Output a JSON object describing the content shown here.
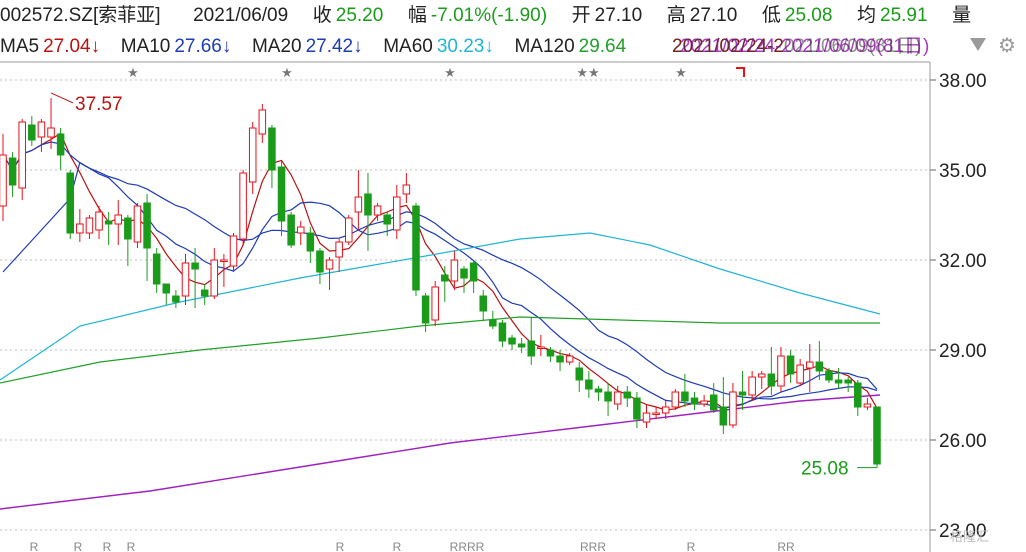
{
  "header": {
    "code": "002572.SZ[索菲亚]",
    "date": "2021/06/09",
    "close_label": "收",
    "close": "25.20",
    "change_label": "幅",
    "change": "-7.01%(-1.90)",
    "open_label": "开",
    "open": "27.10",
    "high_label": "高",
    "high": "27.10",
    "low_label": "低",
    "low": "25.08",
    "avg_label": "均",
    "avg": "25.91",
    "vol_label": "量"
  },
  "ma_bar": {
    "ma5": "MA5",
    "ma5_val": "27.04↓",
    "ma10": "MA10",
    "ma10_val": "27.66↓",
    "ma20": "MA20",
    "ma20_val": "27.42↓",
    "ma60": "MA60",
    "ma60_val": "30.23↓",
    "ma120": "MA120",
    "ma120_val": "29.64",
    "overlap_a": "2021/02/24-2",
    "overlap_b": "2021/02/24-2021/06/09(81日)",
    "period": "2021/02/24-2021/06/09(81日)"
  },
  "colors": {
    "up": "#e8111a",
    "down": "#1a9c1a",
    "ma5": "#bb1111",
    "ma10": "#1e3cb4",
    "ma20": "#1e3cb4",
    "ma60": "#22b4d4",
    "ma120": "#22a02a",
    "ma250": "#a020c0",
    "grid": "#bdbdbd",
    "axis_text": "#222222",
    "high_label": "#bb1111",
    "low_label": "#1a9c1a"
  },
  "icons": {
    "dropdown": "triangle-down-icon",
    "settings": "gear-icon"
  },
  "watermark": "格隆汇",
  "chart_data": {
    "type": "candlestick",
    "ylim": [
      23,
      38.6
    ],
    "yticks": [
      "38.00",
      "35.00",
      "32.00",
      "29.00",
      "26.00",
      "23.00"
    ],
    "high_annotation": "37.57",
    "low_annotation": "25.08",
    "star_marks": [
      "★",
      "★",
      "★",
      "★★",
      "★"
    ],
    "bottom_marks": [
      "R",
      "R",
      "R",
      "R",
      "R",
      "R",
      "RRRR",
      "RRR",
      "R",
      "RR"
    ],
    "candles": [
      [
        33.8,
        35.5,
        33.3,
        36.2
      ],
      [
        35.4,
        34.5,
        34.1,
        35.6
      ],
      [
        34.4,
        36.6,
        34.0,
        36.7
      ],
      [
        36.5,
        36.0,
        35.8,
        36.8
      ],
      [
        36.1,
        36.6,
        35.6,
        36.7
      ],
      [
        36.1,
        36.4,
        35.7,
        37.4
      ],
      [
        36.2,
        35.5,
        35.0,
        36.4
      ],
      [
        34.9,
        32.9,
        32.7,
        35.0
      ],
      [
        32.9,
        33.2,
        32.6,
        33.7
      ],
      [
        32.9,
        33.4,
        32.7,
        33.5
      ],
      [
        33.0,
        33.6,
        32.7,
        33.8
      ],
      [
        33.3,
        33.2,
        32.5,
        33.6
      ],
      [
        33.2,
        33.5,
        32.5,
        34.0
      ],
      [
        33.4,
        32.7,
        31.8,
        33.5
      ],
      [
        32.6,
        33.8,
        32.4,
        33.9
      ],
      [
        33.9,
        32.4,
        31.3,
        34.2
      ],
      [
        32.2,
        31.2,
        30.9,
        32.4
      ],
      [
        31.2,
        30.9,
        30.5,
        31.2
      ],
      [
        30.8,
        30.6,
        30.4,
        31.0
      ],
      [
        30.8,
        31.9,
        30.5,
        32.2
      ],
      [
        31.9,
        31.7,
        30.4,
        32.4
      ],
      [
        31.0,
        30.8,
        30.5,
        31.2
      ],
      [
        30.8,
        32.0,
        30.7,
        32.4
      ],
      [
        32.0,
        32.0,
        31.1,
        32.2
      ],
      [
        31.8,
        32.8,
        31.6,
        32.9
      ],
      [
        32.7,
        34.9,
        32.5,
        35.0
      ],
      [
        34.6,
        36.4,
        34.2,
        36.6
      ],
      [
        36.2,
        37.0,
        35.9,
        37.2
      ],
      [
        36.4,
        35.0,
        34.4,
        36.5
      ],
      [
        35.1,
        33.3,
        32.8,
        35.3
      ],
      [
        33.5,
        32.5,
        32.4,
        33.6
      ],
      [
        32.9,
        33.1,
        32.5,
        33.3
      ],
      [
        32.9,
        32.3,
        31.9,
        33.1
      ],
      [
        32.3,
        31.6,
        31.2,
        32.4
      ],
      [
        31.7,
        32.0,
        31.0,
        32.1
      ],
      [
        32.1,
        32.6,
        31.6,
        32.7
      ],
      [
        32.6,
        33.4,
        32.5,
        33.5
      ],
      [
        33.6,
        34.1,
        33.0,
        35.0
      ],
      [
        34.2,
        33.5,
        32.3,
        34.9
      ],
      [
        33.5,
        33.8,
        33.3,
        33.9
      ],
      [
        33.5,
        33.2,
        32.8,
        33.6
      ],
      [
        33.0,
        34.1,
        32.7,
        34.5
      ],
      [
        34.2,
        34.5,
        33.9,
        34.9
      ],
      [
        33.8,
        31.0,
        30.8,
        33.9
      ],
      [
        30.8,
        29.9,
        29.6,
        30.9
      ],
      [
        30.0,
        31.1,
        29.8,
        31.3
      ],
      [
        31.5,
        31.3,
        30.6,
        31.8
      ],
      [
        31.3,
        32.0,
        31.0,
        32.3
      ],
      [
        31.7,
        31.4,
        30.9,
        31.8
      ],
      [
        31.9,
        31.3,
        30.9,
        32.0
      ],
      [
        30.8,
        30.3,
        30.0,
        31.0
      ],
      [
        30.0,
        29.8,
        29.7,
        30.3
      ],
      [
        29.9,
        29.3,
        29.1,
        30.0
      ],
      [
        29.4,
        29.2,
        29.0,
        29.5
      ],
      [
        29.2,
        29.1,
        28.9,
        29.4
      ],
      [
        29.3,
        28.8,
        28.5,
        30.1
      ],
      [
        29.1,
        29.1,
        28.8,
        29.5
      ],
      [
        29.0,
        28.8,
        28.6,
        29.1
      ],
      [
        28.8,
        28.6,
        28.3,
        29.0
      ],
      [
        28.6,
        28.8,
        28.5,
        28.9
      ],
      [
        28.4,
        28.0,
        27.6,
        28.6
      ],
      [
        28.0,
        27.7,
        27.4,
        28.3
      ],
      [
        27.7,
        27.6,
        27.3,
        27.8
      ],
      [
        27.6,
        27.3,
        26.8,
        27.9
      ],
      [
        27.2,
        27.6,
        27.0,
        27.8
      ],
      [
        27.6,
        27.4,
        27.1,
        27.8
      ],
      [
        27.4,
        26.7,
        26.4,
        27.6
      ],
      [
        26.6,
        26.9,
        26.4,
        27.2
      ],
      [
        26.9,
        26.9,
        26.7,
        27.1
      ],
      [
        26.9,
        27.1,
        26.7,
        27.3
      ],
      [
        27.1,
        27.6,
        27.0,
        27.7
      ],
      [
        27.6,
        27.3,
        27.1,
        28.2
      ],
      [
        27.4,
        27.2,
        27.0,
        27.6
      ],
      [
        27.2,
        27.3,
        27.1,
        27.5
      ],
      [
        27.5,
        27.0,
        26.9,
        27.9
      ],
      [
        27.1,
        26.5,
        26.2,
        28.1
      ],
      [
        26.5,
        27.6,
        26.4,
        27.9
      ],
      [
        27.6,
        27.5,
        27.0,
        28.3
      ],
      [
        27.5,
        28.1,
        27.3,
        28.3
      ],
      [
        28.1,
        28.2,
        27.7,
        28.3
      ],
      [
        28.2,
        27.8,
        27.5,
        29.1
      ],
      [
        27.8,
        28.8,
        27.6,
        29.1
      ],
      [
        28.8,
        28.2,
        27.9,
        29.0
      ],
      [
        27.9,
        28.5,
        27.8,
        28.7
      ],
      [
        28.4,
        28.6,
        27.6,
        29.2
      ],
      [
        28.6,
        28.3,
        28.0,
        29.3
      ],
      [
        28.3,
        28.0,
        27.9,
        28.4
      ],
      [
        28.0,
        27.9,
        27.7,
        28.4
      ],
      [
        28.0,
        27.9,
        27.6,
        28.1
      ],
      [
        27.9,
        27.1,
        26.8,
        28.0
      ],
      [
        27.1,
        27.2,
        27.0,
        27.4
      ],
      [
        27.1,
        25.2,
        25.08,
        27.1
      ]
    ]
  }
}
